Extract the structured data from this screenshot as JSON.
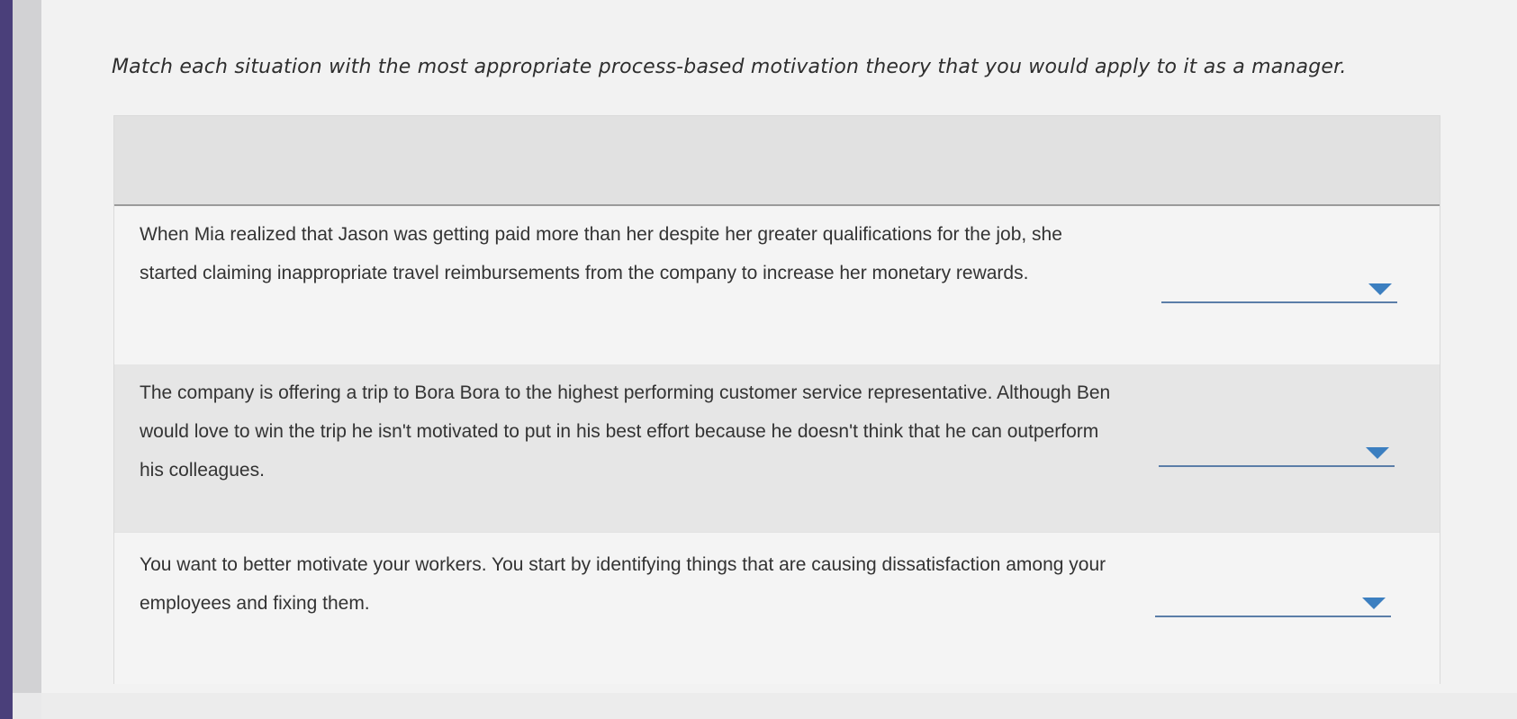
{
  "instruction": "Match each situation with the most appropriate process-based motivation theory that you would apply to it as a manager.",
  "rows": [
    {
      "situation": "When Mia realized that Jason was getting paid more than her despite her greater qualifications for the job, she started claiming inappropriate travel reimbursements from the company to increase her monetary rewards.",
      "selected": ""
    },
    {
      "situation": "The company is offering a trip to Bora Bora to the highest performing customer service representative. Although Ben would love to win the trip he isn't motivated to put in his best effort because he doesn't think that he can outperform his colleagues.",
      "selected": ""
    },
    {
      "situation": "You want to better motivate your workers. You start by identifying things that are causing dissatisfaction among your employees and fixing them.",
      "selected": ""
    }
  ],
  "icons": {
    "dropdown": "caret-down-icon"
  },
  "colors": {
    "dropdown_caret": "#3c7fc0",
    "dropdown_underline": "#5b7ea8"
  }
}
